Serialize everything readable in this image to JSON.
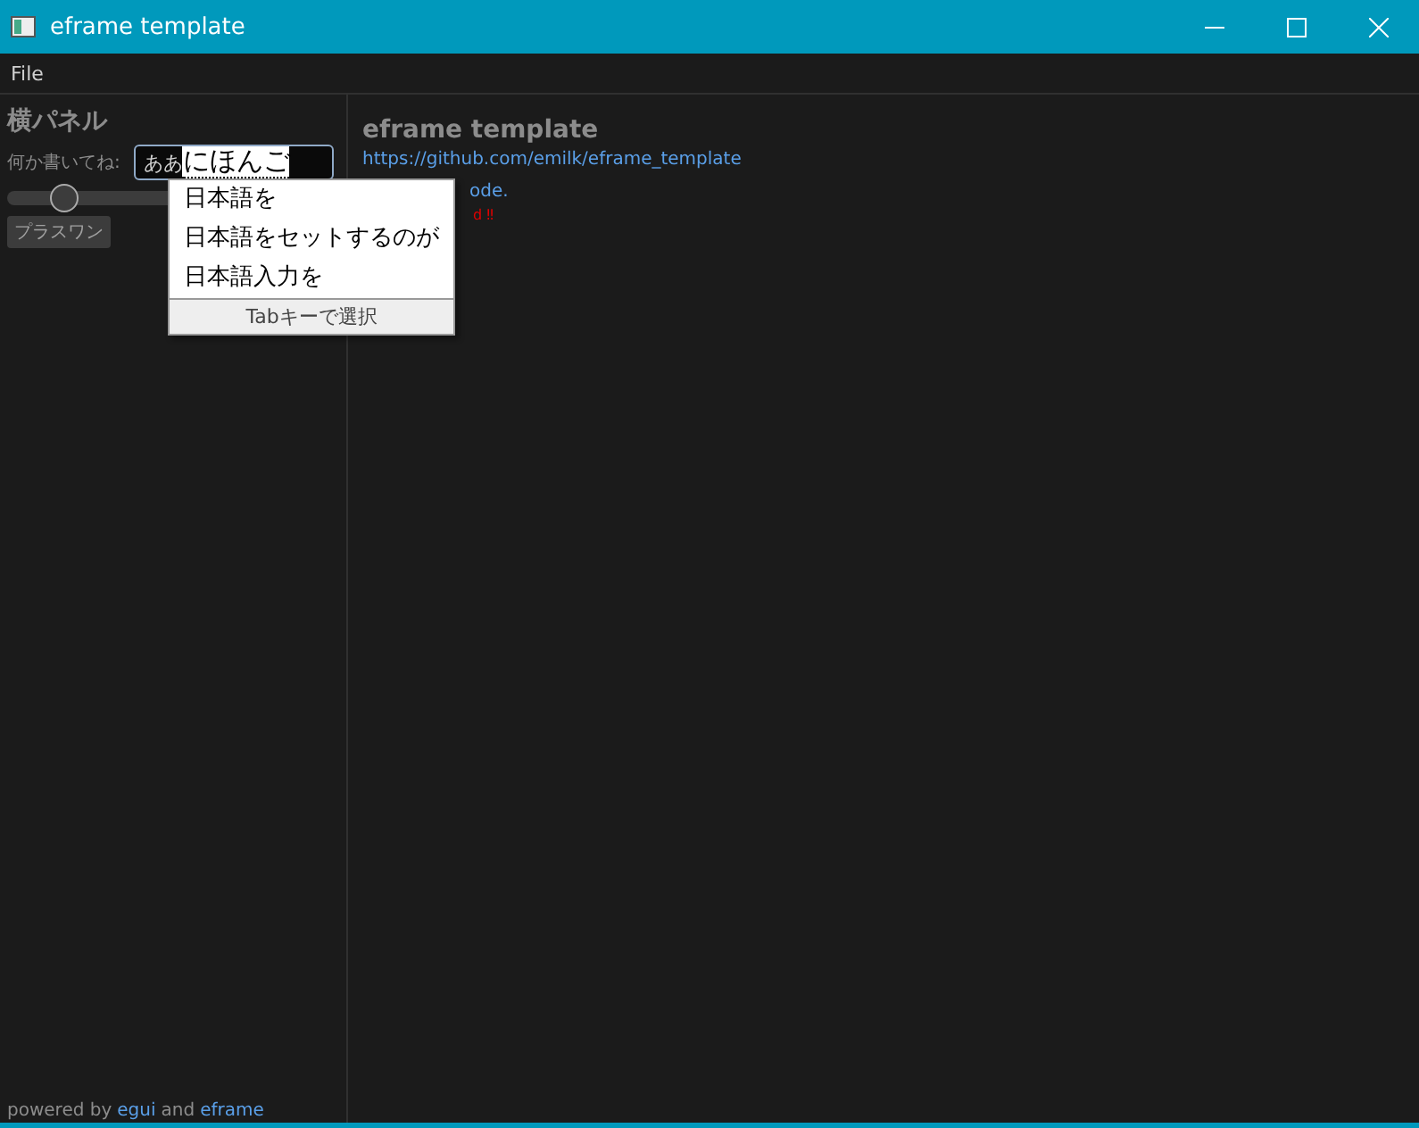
{
  "window": {
    "title": "eframe template"
  },
  "menu": [
    {
      "label": "File"
    }
  ],
  "side_panel": {
    "heading": "横パネル",
    "field_label": "何か書いてね:",
    "field_value": "ああ",
    "composition": "にほんご",
    "slider": {
      "level": 0.17
    },
    "button": "プラスワン",
    "footer": {
      "prefix": "powered by",
      "link1": "egui",
      "middle": "and",
      "link2": "eframe"
    }
  },
  "ime_popup": {
    "candidates": [
      {
        "text": "日本語を"
      },
      {
        "text": "日本語をセットするのが"
      },
      {
        "text": "日本語入力を"
      }
    ],
    "hint": "Tabキーで選択"
  },
  "central_panel": {
    "heading": "eframe template",
    "link": "https://github.com/emilk/eframe_template",
    "line_2": "ode.",
    "line_3": "d ‼"
  }
}
